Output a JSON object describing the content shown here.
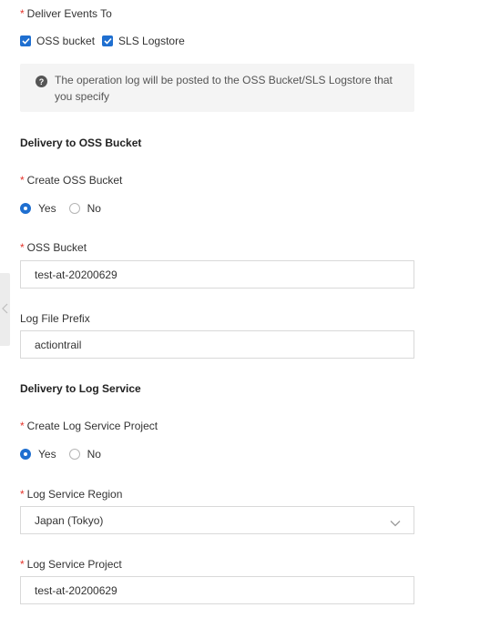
{
  "deliver": {
    "required_mark": "*",
    "label": "Deliver Events To",
    "options": [
      {
        "label": "OSS bucket",
        "checked": true
      },
      {
        "label": "SLS Logstore",
        "checked": true
      }
    ],
    "notice_icon": "help-circle-icon",
    "notice_line1": "The operation log will be posted to the OSS Bucket/SLS Logstore that",
    "notice_line2": "you specify"
  },
  "oss": {
    "section_title": "Delivery to OSS Bucket",
    "create_label": "Create OSS Bucket",
    "yes_label": "Yes",
    "no_label": "No",
    "selected": "Yes",
    "bucket_label": "OSS Bucket",
    "bucket_value": "test-at-20200629",
    "prefix_label": "Log File Prefix",
    "prefix_value": "actiontrail"
  },
  "sls": {
    "section_title": "Delivery to Log Service",
    "create_label": "Create Log Service Project",
    "yes_label": "Yes",
    "no_label": "No",
    "selected": "Yes",
    "region_label": "Log Service Region",
    "region_value": "Japan (Tokyo)",
    "project_label": "Log Service Project",
    "project_value": "test-at-20200629"
  },
  "colors": {
    "accent": "#1f6fd0",
    "required": "#e5342b",
    "notice_bg": "#f4f4f4"
  }
}
